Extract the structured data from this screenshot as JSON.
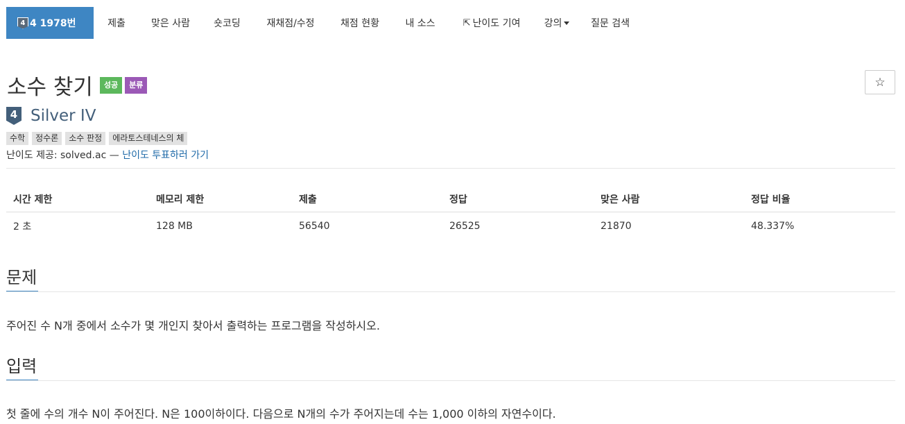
{
  "nav": {
    "active": {
      "tier_badge": "4",
      "label": "4 1978번"
    },
    "items": [
      {
        "label": "제출"
      },
      {
        "label": "맞은 사람"
      },
      {
        "label": "숏코딩"
      },
      {
        "label": "재채점/수정"
      },
      {
        "label": "채점 현황"
      },
      {
        "label": "내 소스"
      },
      {
        "label": "난이도 기여",
        "icon": "external-link-icon"
      },
      {
        "label": "강의",
        "caret": true
      },
      {
        "label": "질문 검색"
      }
    ]
  },
  "problem": {
    "title": "소수 찾기",
    "labels": [
      {
        "text": "성공",
        "color": "#5cb85c"
      },
      {
        "text": "분류",
        "color": "#9b59b6"
      }
    ],
    "star_glyph": "☆",
    "tier_badge": "4",
    "tier_name": "Silver IV",
    "tags": [
      "수학",
      "정수론",
      "소수 판정",
      "에라토스테네스의 체"
    ],
    "provider_prefix": "난이도 제공: solved.ac — ",
    "provider_link": "난이도 투표하러 가기"
  },
  "stats": {
    "headers": [
      "시간 제한",
      "메모리 제한",
      "제출",
      "정답",
      "맞은 사람",
      "정답 비율"
    ],
    "values": [
      "2 초",
      "128 MB",
      "56540",
      "26525",
      "21870",
      "48.337%"
    ]
  },
  "sections": {
    "problem_heading": "문제",
    "problem_text": "주어진 수 N개 중에서 소수가 몇 개인지 찾아서 출력하는 프로그램을 작성하시오.",
    "input_heading": "입력",
    "input_text": "첫 줄에 수의 개수 N이 주어진다. N은 100이하이다. 다음으로 N개의 수가 주어지는데 수는 1,000 이하의 자연수이다."
  }
}
